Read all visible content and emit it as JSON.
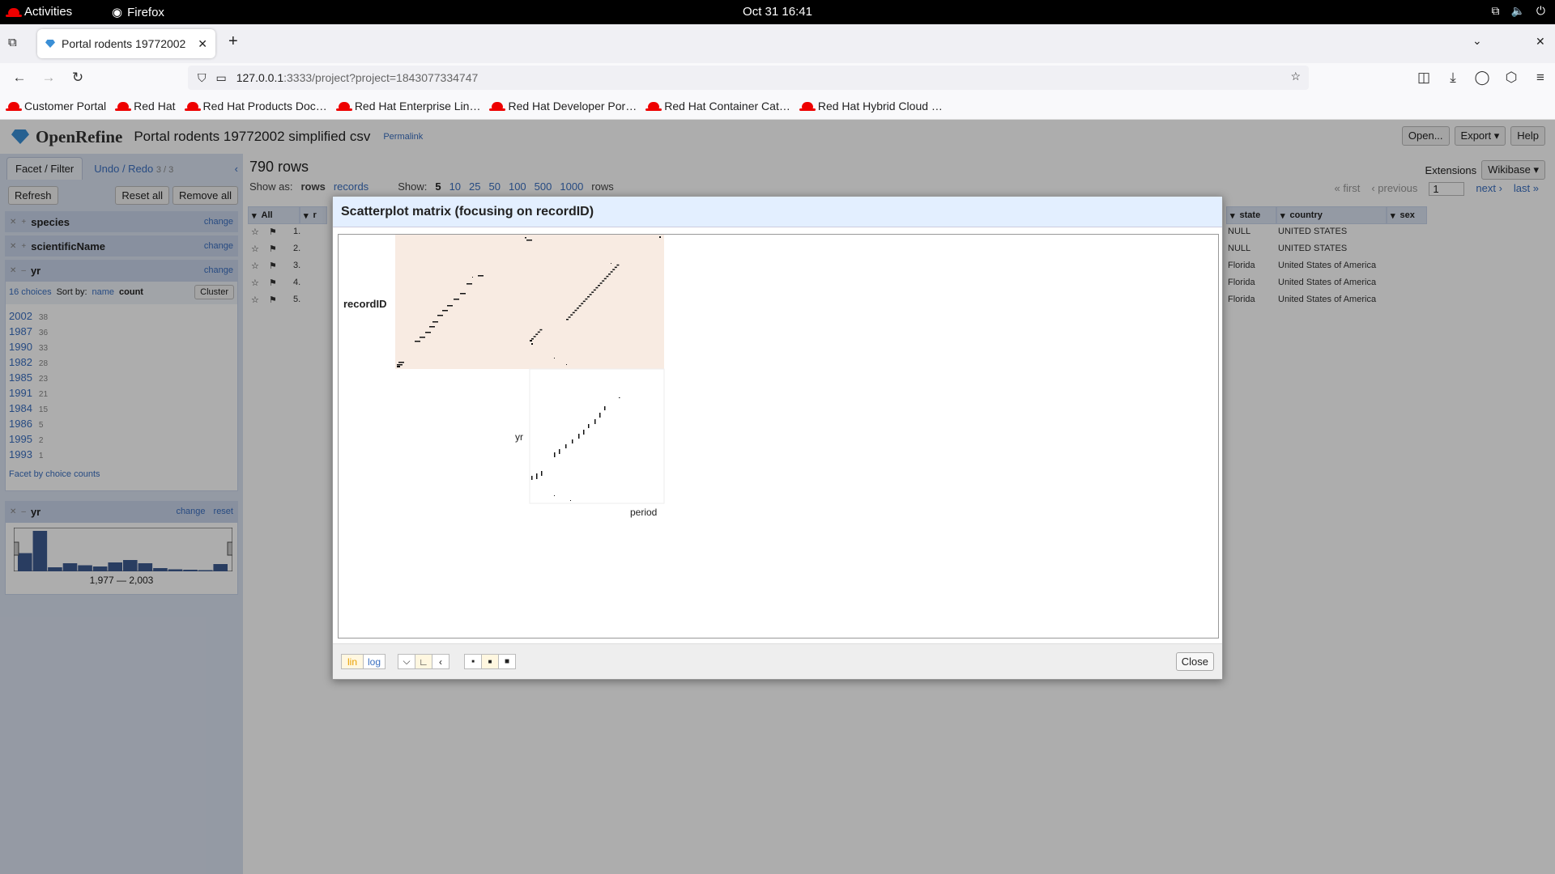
{
  "gnome": {
    "activities": "Activities",
    "app": "Firefox",
    "clock": "Oct 31  16:41"
  },
  "browser": {
    "tab_title": "Portal rodents 19772002",
    "url_host": "127.0.0.1",
    "url_rest": ":3333/project?project=1843077334747",
    "bookmarks": [
      "Customer Portal",
      "Red Hat",
      "Red Hat Products Doc…",
      "Red Hat Enterprise Lin…",
      "Red Hat Developer Por…",
      "Red Hat Container Cat…",
      "Red Hat Hybrid Cloud …"
    ]
  },
  "app": {
    "logo": "OpenRefine",
    "project": "Portal rodents 19772002 simplified csv",
    "permalink": "Permalink",
    "buttons": {
      "open": "Open...",
      "export": "Export ▾",
      "help": "Help"
    },
    "extensions_label": "Extensions",
    "wikibase": "Wikibase ▾"
  },
  "left": {
    "tab_facet": "Facet / Filter",
    "tab_undo": "Undo / Redo",
    "undo_count": "3 / 3",
    "refresh": "Refresh",
    "reset_all": "Reset all",
    "remove_all": "Remove all",
    "facets": [
      {
        "name": "species",
        "change": "change"
      },
      {
        "name": "scientificName",
        "change": "change"
      },
      {
        "name": "yr",
        "change": "change"
      }
    ],
    "choices_label": "16 choices",
    "sort_by": "Sort by:",
    "sort_name": "name",
    "sort_count": "count",
    "cluster": "Cluster",
    "choices": [
      {
        "name": "2002",
        "count": "38"
      },
      {
        "name": "1987",
        "count": "36"
      },
      {
        "name": "1990",
        "count": "33"
      },
      {
        "name": "1982",
        "count": "28"
      },
      {
        "name": "1985",
        "count": "23"
      },
      {
        "name": "1991",
        "count": "21"
      },
      {
        "name": "1984",
        "count": "15"
      },
      {
        "name": "1986",
        "count": "5"
      },
      {
        "name": "1995",
        "count": "2"
      },
      {
        "name": "1993",
        "count": "1"
      }
    ],
    "facet_by_counts": "Facet by choice counts",
    "numeric_facet": {
      "name": "yr",
      "change": "change",
      "reset": "reset",
      "range": "1,977 — 2,003",
      "histogram": [
        0.45,
        1.0,
        0.1,
        0.2,
        0.15,
        0.12,
        0.22,
        0.28,
        0.2,
        0.08,
        0.05,
        0.04,
        0.03,
        0.18
      ]
    }
  },
  "main": {
    "rows_title": "790 rows",
    "show_as": "Show as:",
    "rows": "rows",
    "records": "records",
    "show": "Show:",
    "page_sizes": [
      "5",
      "10",
      "25",
      "50",
      "100",
      "500",
      "1000"
    ],
    "rows_suffix": "rows",
    "pager": {
      "first": "« first",
      "previous": "‹ previous",
      "page": "1",
      "next": "next ›",
      "last": "last »"
    },
    "col_all": "All",
    "col_r": "r",
    "row_numbers": [
      "1.",
      "2.",
      "3.",
      "4.",
      "5."
    ],
    "columns_right": [
      "state",
      "country",
      "sex"
    ],
    "rows_right": [
      {
        "state": "NULL",
        "country": "UNITED STATES"
      },
      {
        "state": "NULL",
        "country": "UNITED STATES"
      },
      {
        "state": "Florida",
        "country": "United States of America"
      },
      {
        "state": "Florida",
        "country": "United States of America"
      },
      {
        "state": "Florida",
        "country": "United States of America"
      }
    ]
  },
  "dialog": {
    "title": "Scatterplot matrix (focusing on recordID)",
    "row_labels": [
      "recordID",
      "yr"
    ],
    "col_label": "period",
    "buttons": {
      "lin": "lin",
      "log": "log",
      "close": "Close"
    },
    "highlight_color": "#f8ebe2"
  }
}
